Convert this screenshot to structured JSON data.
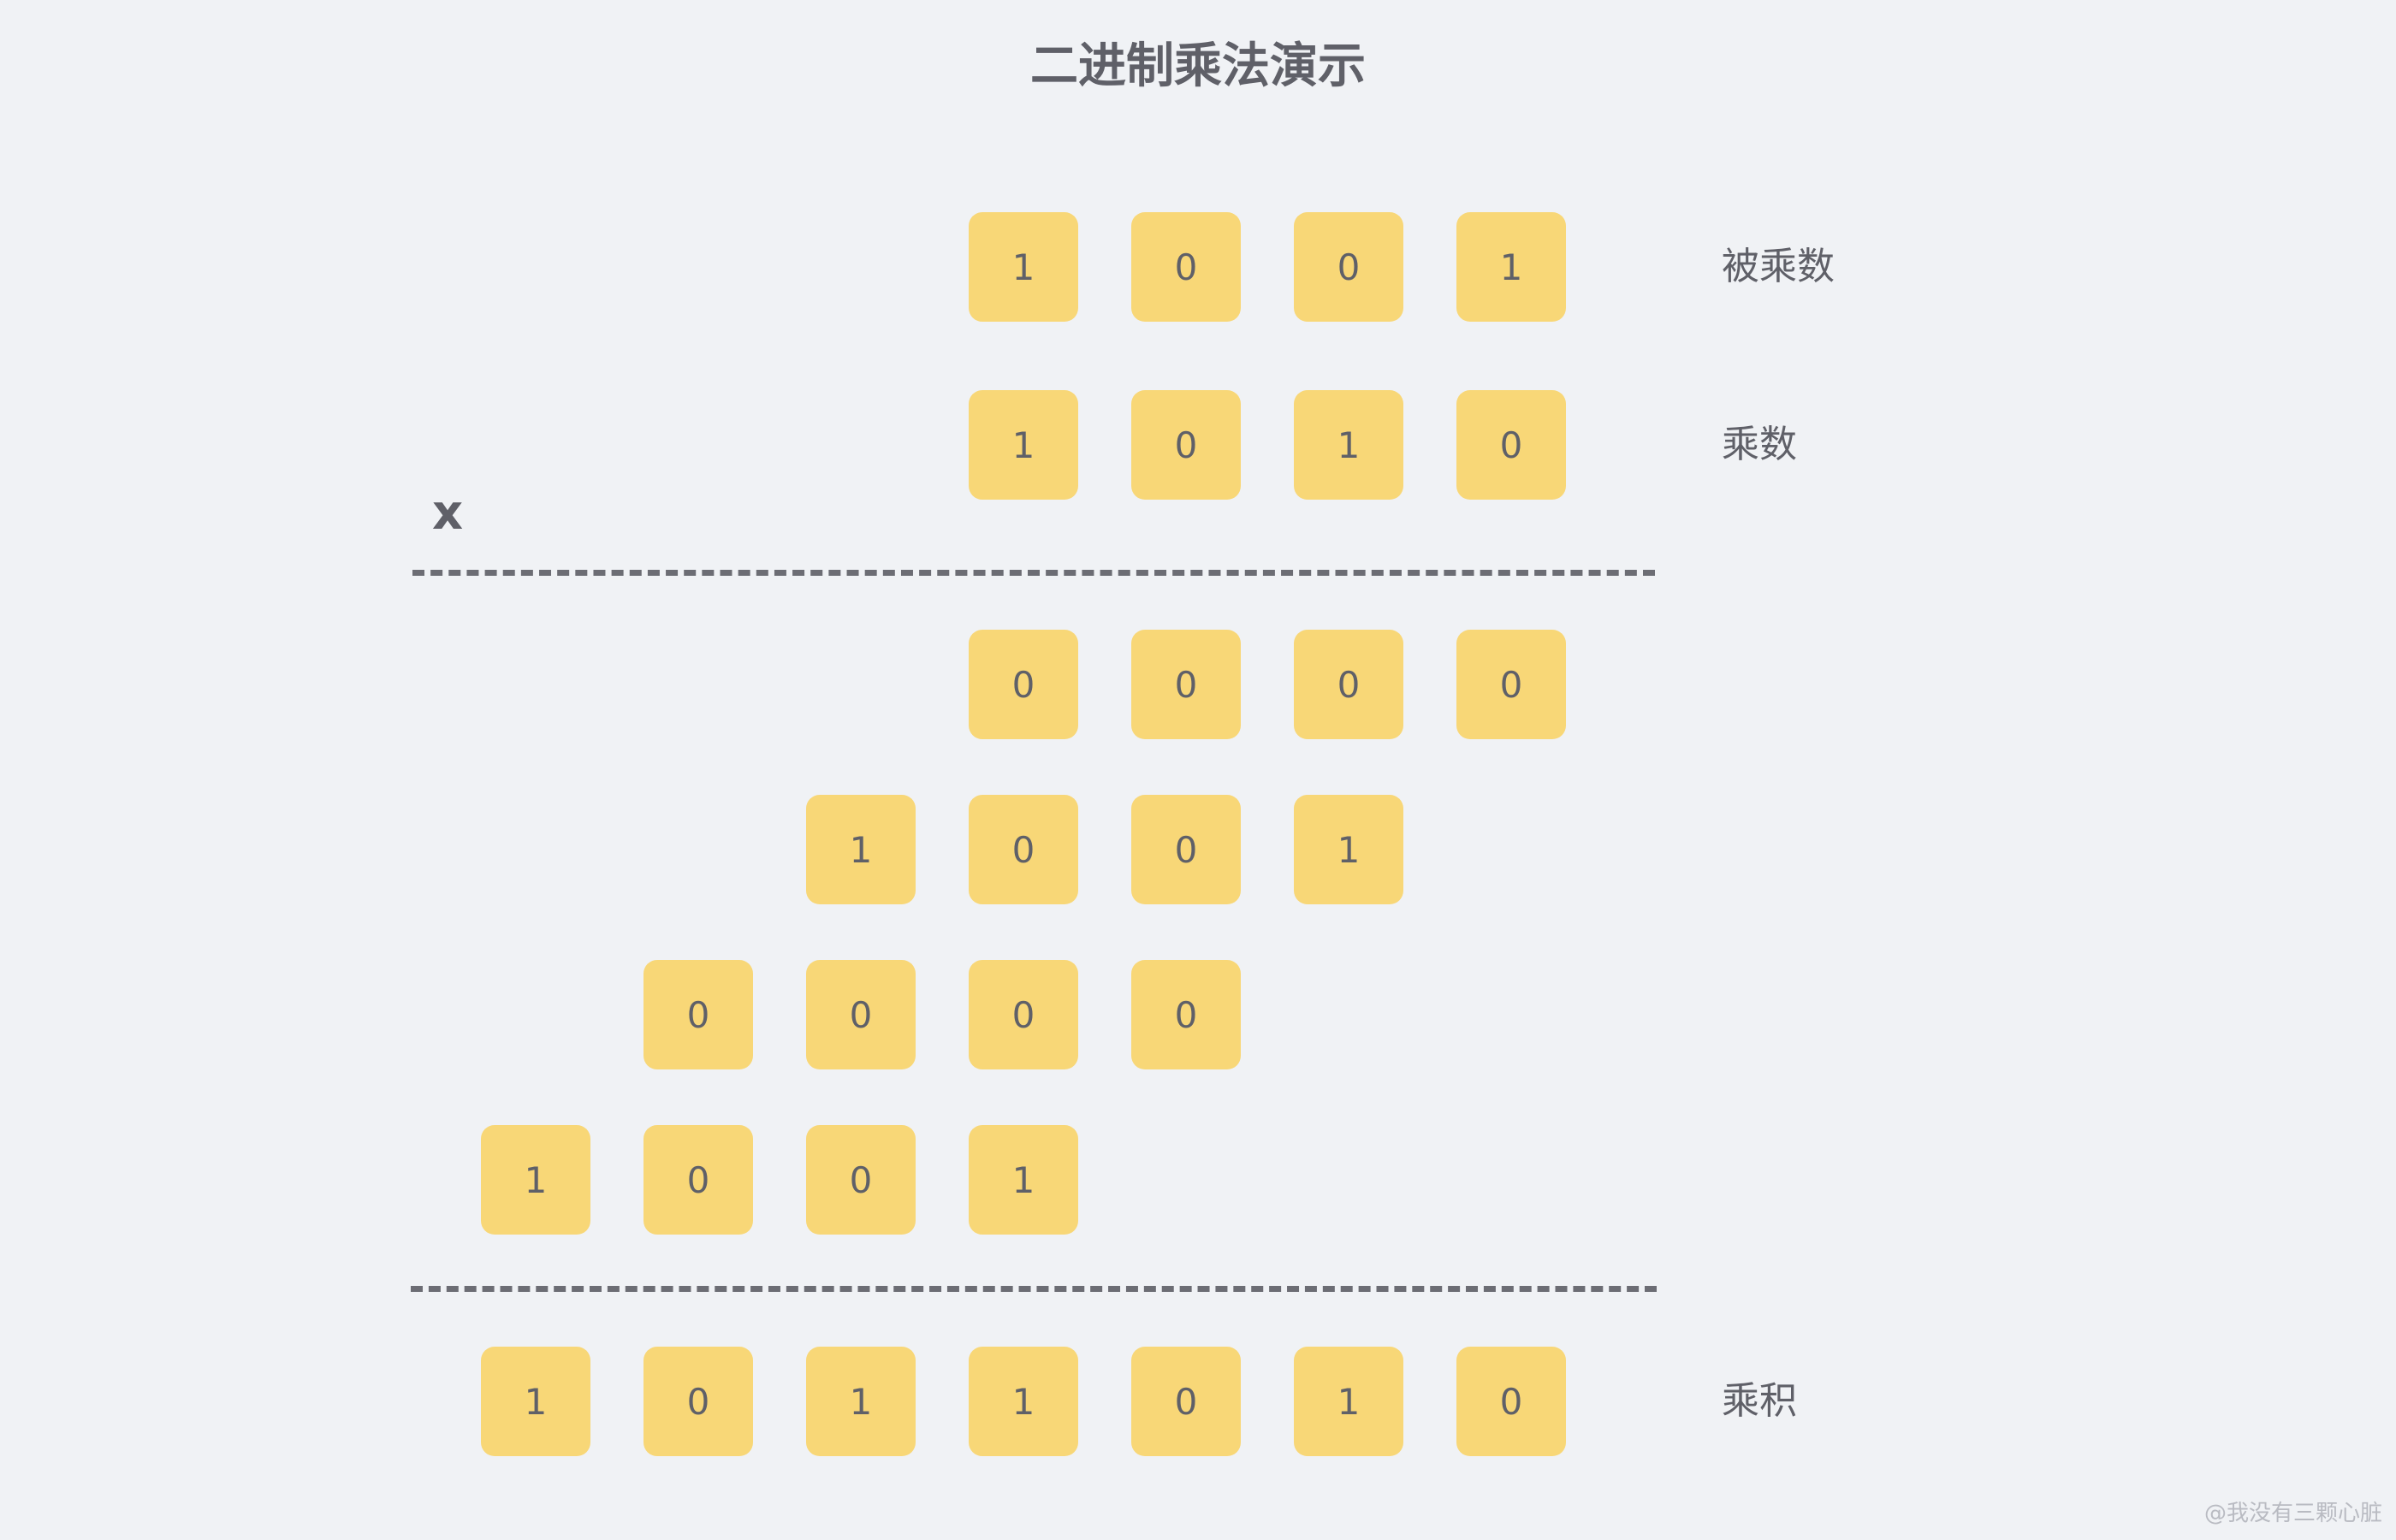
{
  "title": "二进制乘法演示",
  "operator": "x",
  "rows": [
    {
      "label": "被乘数",
      "digits": [
        "1",
        "0",
        "0",
        "1"
      ]
    },
    {
      "label": "乘数",
      "digits": [
        "1",
        "0",
        "1",
        "0"
      ]
    },
    {
      "label": "",
      "digits": [
        "0",
        "0",
        "0",
        "0"
      ]
    },
    {
      "label": "",
      "digits": [
        "1",
        "0",
        "0",
        "1"
      ]
    },
    {
      "label": "",
      "digits": [
        "0",
        "0",
        "0",
        "0"
      ]
    },
    {
      "label": "",
      "digits": [
        "1",
        "0",
        "0",
        "1"
      ]
    },
    {
      "label": "乘积",
      "digits": [
        "1",
        "0",
        "1",
        "1",
        "0",
        "1",
        "0"
      ]
    }
  ],
  "colors": {
    "background": "#f0f2f5",
    "cell_fill": "#f8d777",
    "text": "#5f6068",
    "divider": "#6c6d74"
  },
  "watermark": "@我没有三颗心脏"
}
